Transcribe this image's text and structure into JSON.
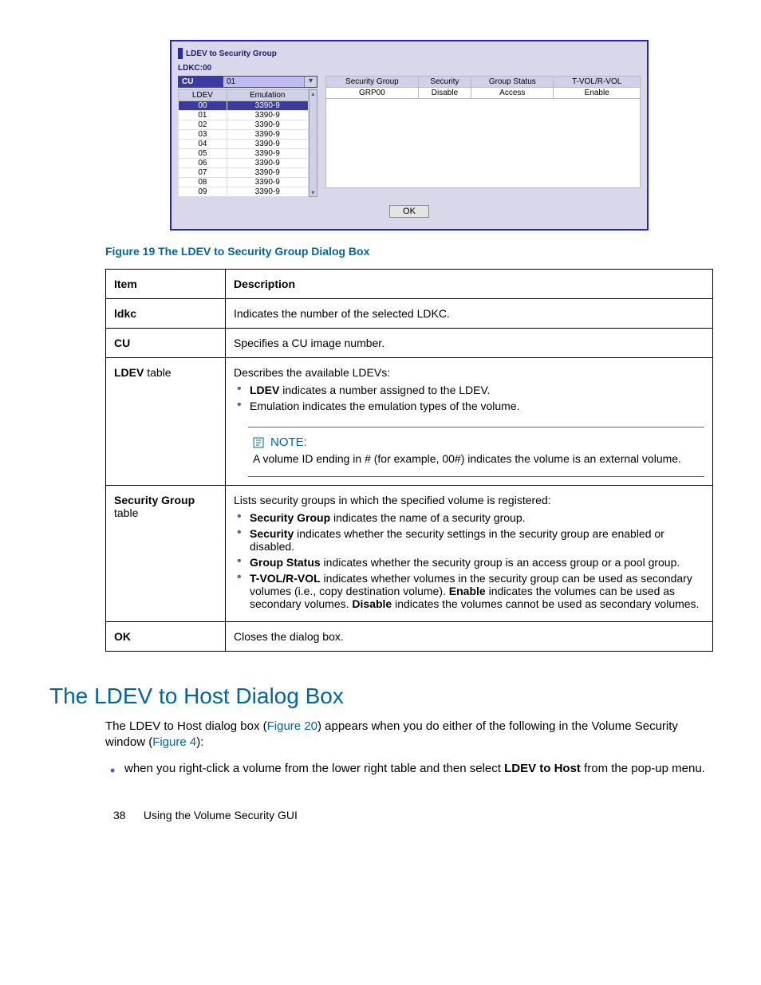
{
  "dialog": {
    "title": "LDEV to Security Group",
    "ldkc_label": "LDKC:00",
    "cu_label": "CU",
    "cu_value": "01",
    "ldev_headers": [
      "LDEV",
      "Emulation"
    ],
    "ldev_rows": [
      {
        "ldev": "00",
        "emu": "3390-9",
        "sel": true
      },
      {
        "ldev": "01",
        "emu": "3390-9"
      },
      {
        "ldev": "02",
        "emu": "3390-9"
      },
      {
        "ldev": "03",
        "emu": "3390-9"
      },
      {
        "ldev": "04",
        "emu": "3390-9"
      },
      {
        "ldev": "05",
        "emu": "3390-9"
      },
      {
        "ldev": "06",
        "emu": "3390-9"
      },
      {
        "ldev": "07",
        "emu": "3390-9"
      },
      {
        "ldev": "08",
        "emu": "3390-9"
      },
      {
        "ldev": "09",
        "emu": "3390-9"
      }
    ],
    "sec_headers": [
      "Security Group",
      "Security",
      "Group Status",
      "T-VOL/R-VOL"
    ],
    "sec_row": [
      "GRP00",
      "Disable",
      "Access",
      "Enable"
    ],
    "ok_label": "OK"
  },
  "figure_caption": "Figure 19 The LDEV to Security Group Dialog Box",
  "desc": {
    "head_item": "Item",
    "head_desc": "Description",
    "rows": {
      "ldkc": {
        "item": "ldkc",
        "text": "Indicates the number of the selected LDKC."
      },
      "cu": {
        "item": "CU",
        "text": "Specifies a CU image number."
      },
      "ldev": {
        "item_bold": "LDEV",
        "item_rest": " table",
        "lead": "Describes the available LDEVs:",
        "b1_bold": "LDEV",
        "b1_rest": " indicates a number assigned to the LDEV.",
        "b2": "Emulation indicates the emulation types of the volume.",
        "note_label": "NOTE:",
        "note_text": "A volume ID ending in # (for example, 00#) indicates the volume is an external volume."
      },
      "sg": {
        "item_bold": "Security Group",
        "item_rest": " table",
        "lead": "Lists security groups in which the specified volume is registered:",
        "b1_bold": "Security Group",
        "b1_rest": " indicates the name of a security group.",
        "b2_bold": "Security",
        "b2_rest": " indicates whether the security settings in the security group are enabled or disabled.",
        "b3_bold": "Group Status",
        "b3_rest": " indicates whether the security group is an access group or a pool group.",
        "b4_bold": "T-VOL/R-VOL",
        "b4_mid": " indicates whether volumes in the security group can be used as secondary volumes (i.e., copy destination volume). ",
        "b4_en": "Enable",
        "b4_mid2": " indicates the volumes can be used as secondary volumes. ",
        "b4_dis": "Disable",
        "b4_end": " indicates the volumes cannot be used as secondary volumes."
      },
      "ok": {
        "item": "OK",
        "text": "Closes the dialog box."
      }
    }
  },
  "section": {
    "heading": "The LDEV to Host Dialog Box",
    "p1a": "The LDEV to Host dialog box (",
    "p1_link1": "Figure 20",
    "p1b": ") appears when you do either of the following in the Volume Security window (",
    "p1_link2": "Figure 4",
    "p1c": "):",
    "li1a": "when you right-click a volume from the lower right table and then select ",
    "li1_bold": "LDEV to Host",
    "li1b": " from the pop-up menu."
  },
  "footer": {
    "page": "38",
    "text": "Using the Volume Security GUI"
  }
}
